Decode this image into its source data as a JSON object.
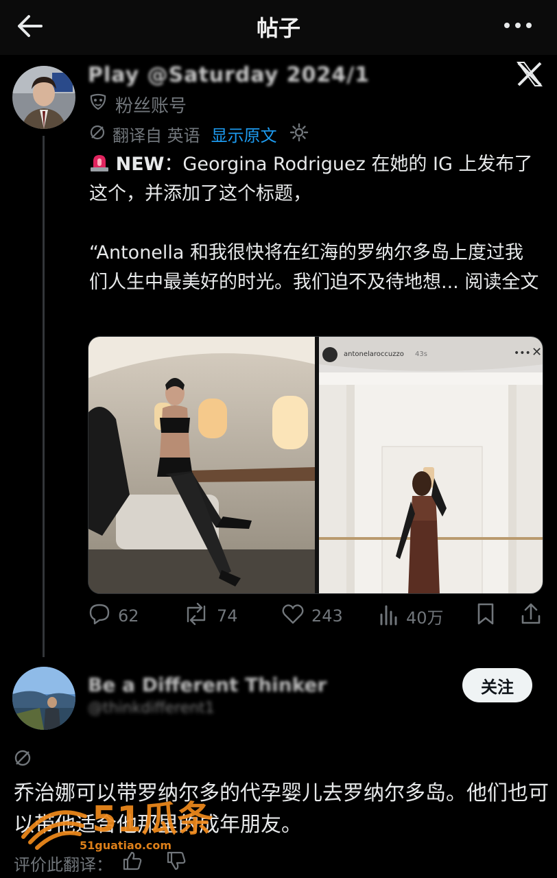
{
  "header": {
    "title": "帖子"
  },
  "post": {
    "author_name_blurred": "Play @Saturday 2024/1",
    "account_type": "粉丝账号",
    "translation": {
      "label": "翻译自 英语",
      "show_original": "显示原文"
    },
    "paragraphs": [
      "NEW：Georgina Rodriguez 在她的 IG 上发布了这个，并添加了这个标题，",
      "",
      "“Antonella 和我很快将在红海的罗纳尔多岛上度过我们人生中最美好的时光。我们迫不及待地想..."
    ],
    "new_label": "NEW",
    "line1_rest": "：Georgina Rodriguez 在她的 IG 上发布了这个，并添加了这个标题，",
    "quote_text": "“Antonella 和我很快将在红海的罗纳尔多岛上度过我们人生中最美好的时光。我们迫不及待地想...",
    "read_more": "阅读全文",
    "media": {
      "story_username": "antonelaroccuzzo",
      "story_time": "43s"
    },
    "stats": {
      "replies": "62",
      "reposts": "74",
      "likes": "243",
      "views": "40万"
    }
  },
  "reply": {
    "author_name_blurred": "Be a Different Thinker",
    "handle_blurred": "@thinkdifferent1",
    "follow_label": "关注",
    "text": "乔治娜可以带罗纳尔多的代孕婴儿去罗纳尔多岛。他们也可以带他适合他那里的成年朋友。",
    "rate_label": "评价此翻译："
  },
  "watermark": {
    "brand": "51瓜条",
    "url": "51guatiao.com"
  },
  "colors": {
    "background": "#000000",
    "text": "#e7e9ea",
    "muted": "#71767b",
    "link": "#1d9bf0",
    "watermark": "#f08a1c"
  }
}
